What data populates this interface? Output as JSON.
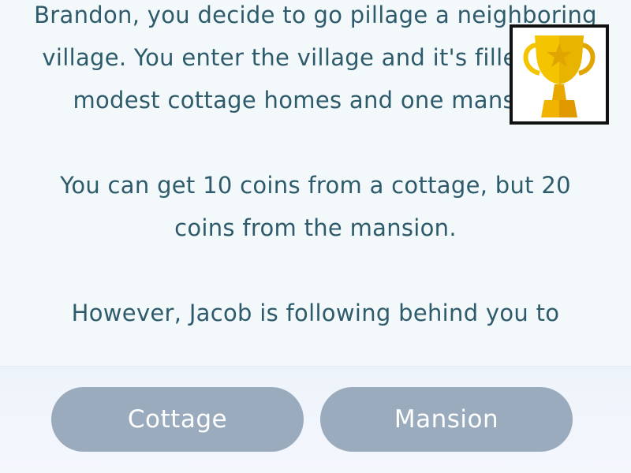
{
  "story": {
    "paragraphs": [
      "Brandon, you decide to go pillage a neighboring village. You enter the village and it's filled with modest cottage homes and one mansion.",
      "You can get 10 coins from a cottage, but 20 coins from the mansion.",
      "However, Jacob is following behind you to"
    ]
  },
  "trophy": {
    "icon": "trophy-icon",
    "colors": {
      "gold": "#f5c400",
      "gold_dark": "#e0a500",
      "base": "#f0b400"
    }
  },
  "choices": [
    {
      "label": "Cottage"
    },
    {
      "label": "Mansion"
    }
  ],
  "colors": {
    "text": "#2e5b6b",
    "button_bg": "#9aabbd",
    "button_text": "#ffffff",
    "page_bg": "#f3f8fb"
  }
}
